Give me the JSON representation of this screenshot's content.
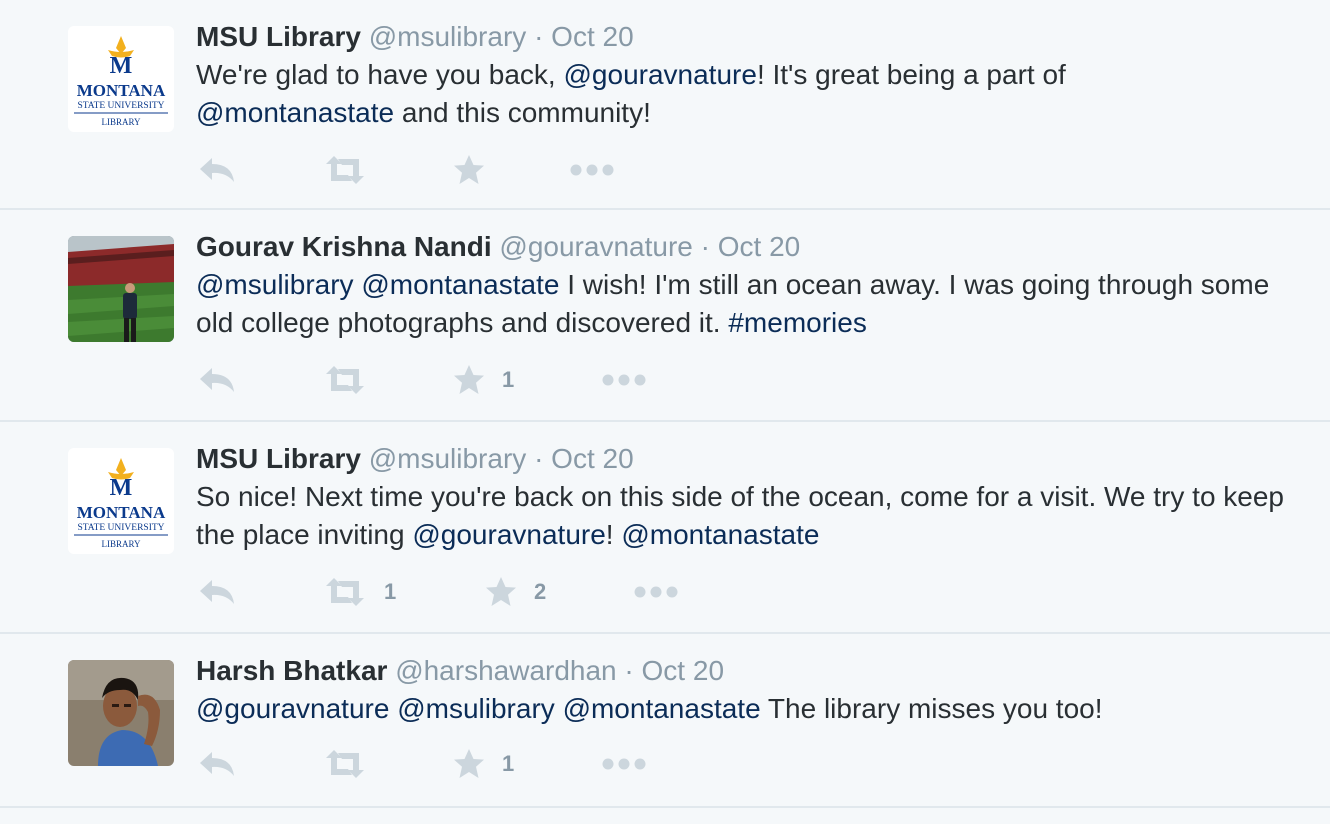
{
  "tweets": [
    {
      "name": "MSU Library",
      "handle": "@msulibrary",
      "separator": "·",
      "time": "Oct 20",
      "avatar": "msu-library-logo",
      "logo_text": {
        "letter": "M",
        "line1": "MONTANA",
        "line2": "STATE UNIVERSITY",
        "line3": "LIBRARY"
      },
      "text_parts": [
        {
          "t": "We're glad to have you back, "
        },
        {
          "t": "@gouravnature",
          "link": true
        },
        {
          "t": "! It's great being a part of "
        },
        {
          "t": "@montanastate",
          "link": true
        },
        {
          "t": " and this community!"
        }
      ],
      "actions": {
        "retweets": "",
        "favorites": ""
      }
    },
    {
      "name": "Gourav Krishna Nandi",
      "handle": "@gouravnature",
      "separator": "·",
      "time": "Oct 20",
      "avatar": "stadium-photo",
      "text_parts": [
        {
          "t": "@msulibrary",
          "link": true
        },
        {
          "t": " "
        },
        {
          "t": "@montanastate",
          "link": true
        },
        {
          "t": " I wish! I'm still an ocean away. I was going through some old college photographs and discovered it. "
        },
        {
          "t": "#memories",
          "link": true
        }
      ],
      "actions": {
        "retweets": "",
        "favorites": "1"
      }
    },
    {
      "name": "MSU Library",
      "handle": "@msulibrary",
      "separator": "·",
      "time": "Oct 20",
      "avatar": "msu-library-logo",
      "logo_text": {
        "letter": "M",
        "line1": "MONTANA",
        "line2": "STATE UNIVERSITY",
        "line3": "LIBRARY"
      },
      "text_parts": [
        {
          "t": "So nice! Next time you're back on this side of the ocean, come for a visit. We try to keep the place inviting "
        },
        {
          "t": "@gouravnature",
          "link": true
        },
        {
          "t": "! "
        },
        {
          "t": "@montanastate",
          "link": true
        }
      ],
      "actions": {
        "retweets": "1",
        "favorites": "2"
      }
    },
    {
      "name": "Harsh Bhatkar",
      "handle": "@harshawardhan",
      "separator": "·",
      "time": "Oct 20",
      "avatar": "person-photo",
      "text_parts": [
        {
          "t": "@gouravnature",
          "link": true
        },
        {
          "t": " "
        },
        {
          "t": "@msulibrary",
          "link": true
        },
        {
          "t": " "
        },
        {
          "t": "@montanastate",
          "link": true
        },
        {
          "t": " The library misses you too!"
        }
      ],
      "actions": {
        "retweets": "",
        "favorites": "1"
      }
    }
  ],
  "colors": {
    "link": "#0b2c57",
    "muted": "#8899a6",
    "icon": "#ccd6dd",
    "background": "#f5f8fa"
  }
}
